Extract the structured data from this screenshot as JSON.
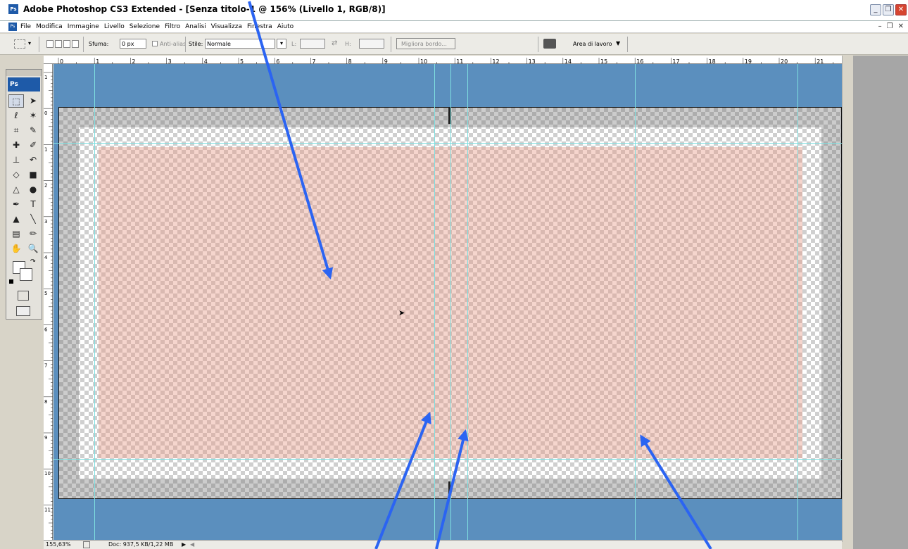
{
  "window": {
    "title": "Adobe Photoshop CS3 Extended - [Senza titolo-1 @ 156% (Livello 1, RGB/8)]"
  },
  "menu": {
    "items": [
      "File",
      "Modifica",
      "Immagine",
      "Livello",
      "Selezione",
      "Filtro",
      "Analisi",
      "Visualizza",
      "Finestra",
      "Aiuto"
    ]
  },
  "options": {
    "sfuma_label": "Sfuma:",
    "sfuma_value": "0 px",
    "antialias_label": "Anti-alias",
    "stile_label": "Stile:",
    "stile_value": "Normale",
    "l_label": "L:",
    "h_label": "H:",
    "migliora_bordo": "Migliora bordo...",
    "area_lavoro": "Area di lavoro"
  },
  "ruler": {
    "top": [
      "0",
      "1",
      "2",
      "3",
      "4",
      "5",
      "6",
      "7",
      "8",
      "9",
      "10",
      "11",
      "12",
      "13",
      "14",
      "15",
      "16",
      "17",
      "18",
      "19",
      "20",
      "21"
    ],
    "left": [
      "1",
      "0",
      "1",
      "2",
      "3",
      "4",
      "5",
      "6",
      "7",
      "8",
      "9",
      "10",
      "11"
    ]
  },
  "status": {
    "zoom": "155,63%",
    "doc": "Doc: 937,5 KB/1,22 MB"
  },
  "toolbox": {
    "logo": "Ps"
  },
  "colors": {
    "canvas_bg": "#5b8fbe",
    "guide": "#7fdfe0",
    "arrow": "#2b64f2",
    "pink_fill": "#e69b87"
  }
}
